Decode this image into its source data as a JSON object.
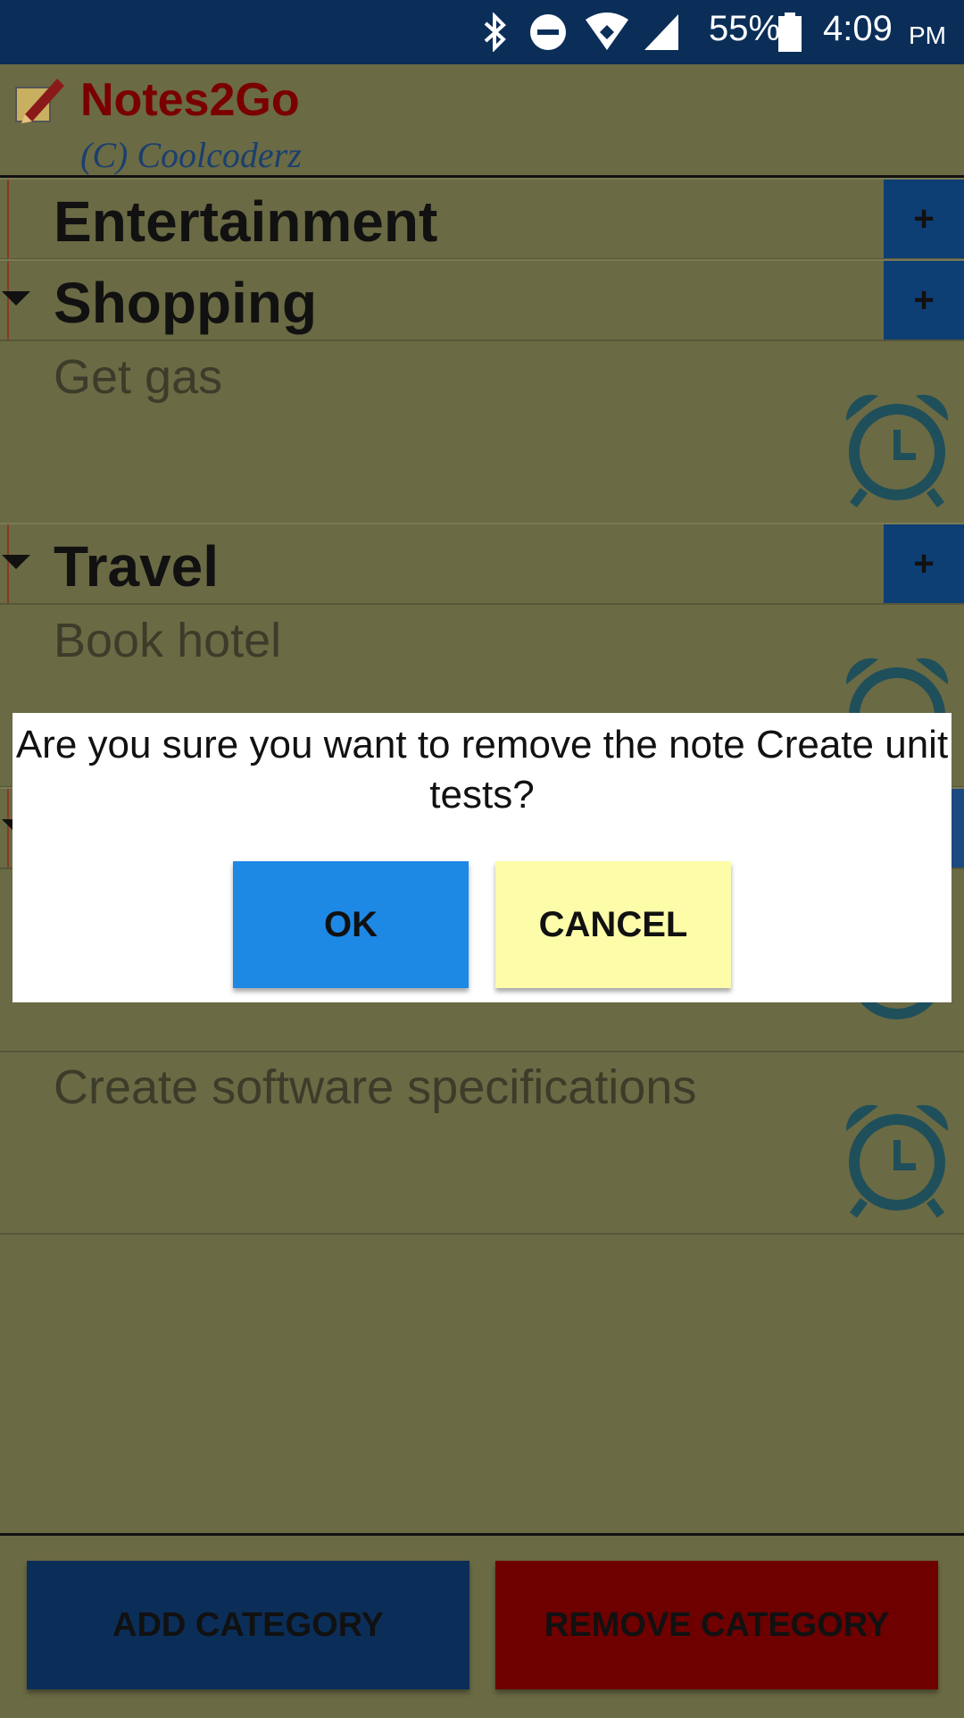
{
  "status_bar": {
    "battery": "55%",
    "time": "4:09",
    "ampm": "PM",
    "icons": [
      "bluetooth-icon",
      "do-not-disturb-icon",
      "wifi-icon",
      "cell-signal-icon",
      "battery-icon"
    ]
  },
  "header": {
    "title": "Notes2Go",
    "copyright": "(C) Coolcoderz"
  },
  "categories": [
    {
      "label": "Entertainment",
      "add": "+"
    },
    {
      "label": "Shopping",
      "add": "+"
    },
    {
      "label": "Travel",
      "add": "+"
    }
  ],
  "notes": [
    {
      "label": "Get gas"
    },
    {
      "label": "Book hotel"
    },
    {
      "label": "Create software specifications"
    }
  ],
  "dialog": {
    "message": "Are you sure you want to remove the note Create unit tests?",
    "ok": "OK",
    "cancel": "CANCEL"
  },
  "bottom": {
    "add_category": "ADD CATEGORY",
    "remove_category": "REMOVE CATEGORY"
  },
  "colors": {
    "status_bar": "#0b2e59",
    "background": "#6a6a44",
    "ok_button": "#1e88e5",
    "cancel_button": "#fdfda9",
    "add_category": "#0b2e59",
    "remove_category": "#6e0000",
    "title": "#7a0000"
  }
}
